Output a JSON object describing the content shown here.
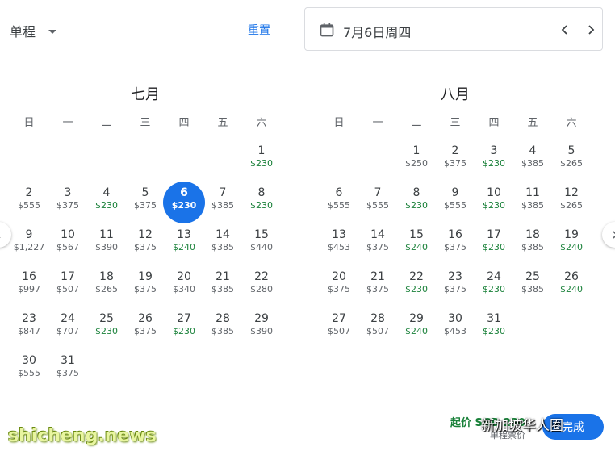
{
  "header": {
    "trip_type": "单程",
    "reset": "重置",
    "selected_date": "7月6日周四"
  },
  "weekdays": [
    "日",
    "一",
    "二",
    "三",
    "四",
    "五",
    "六"
  ],
  "months": [
    {
      "title": "七月",
      "lead_blanks": 6,
      "days": [
        {
          "d": "1",
          "p": "$230",
          "low": true
        },
        {
          "d": "2",
          "p": "$555"
        },
        {
          "d": "3",
          "p": "$375"
        },
        {
          "d": "4",
          "p": "$230",
          "low": true
        },
        {
          "d": "5",
          "p": "$375"
        },
        {
          "d": "6",
          "p": "$230",
          "low": true,
          "selected": true
        },
        {
          "d": "7",
          "p": "$385"
        },
        {
          "d": "8",
          "p": "$230",
          "low": true
        },
        {
          "d": "9",
          "p": "$1,227"
        },
        {
          "d": "10",
          "p": "$567"
        },
        {
          "d": "11",
          "p": "$390"
        },
        {
          "d": "12",
          "p": "$375"
        },
        {
          "d": "13",
          "p": "$240",
          "low": true
        },
        {
          "d": "14",
          "p": "$385"
        },
        {
          "d": "15",
          "p": "$440"
        },
        {
          "d": "16",
          "p": "$997"
        },
        {
          "d": "17",
          "p": "$507"
        },
        {
          "d": "18",
          "p": "$265"
        },
        {
          "d": "19",
          "p": "$375"
        },
        {
          "d": "20",
          "p": "$340"
        },
        {
          "d": "21",
          "p": "$385"
        },
        {
          "d": "22",
          "p": "$280"
        },
        {
          "d": "23",
          "p": "$847"
        },
        {
          "d": "24",
          "p": "$707"
        },
        {
          "d": "25",
          "p": "$230",
          "low": true
        },
        {
          "d": "26",
          "p": "$375"
        },
        {
          "d": "27",
          "p": "$230",
          "low": true
        },
        {
          "d": "28",
          "p": "$385"
        },
        {
          "d": "29",
          "p": "$390"
        },
        {
          "d": "30",
          "p": "$555"
        },
        {
          "d": "31",
          "p": "$375"
        }
      ]
    },
    {
      "title": "八月",
      "lead_blanks": 2,
      "days": [
        {
          "d": "1",
          "p": "$250"
        },
        {
          "d": "2",
          "p": "$375"
        },
        {
          "d": "3",
          "p": "$230",
          "low": true
        },
        {
          "d": "4",
          "p": "$385"
        },
        {
          "d": "5",
          "p": "$265"
        },
        {
          "d": "6",
          "p": "$555"
        },
        {
          "d": "7",
          "p": "$555"
        },
        {
          "d": "8",
          "p": "$230",
          "low": true
        },
        {
          "d": "9",
          "p": "$555"
        },
        {
          "d": "10",
          "p": "$230",
          "low": true
        },
        {
          "d": "11",
          "p": "$385"
        },
        {
          "d": "12",
          "p": "$265"
        },
        {
          "d": "13",
          "p": "$453"
        },
        {
          "d": "14",
          "p": "$375"
        },
        {
          "d": "15",
          "p": "$240",
          "low": true
        },
        {
          "d": "16",
          "p": "$375"
        },
        {
          "d": "17",
          "p": "$230",
          "low": true
        },
        {
          "d": "18",
          "p": "$385"
        },
        {
          "d": "19",
          "p": "$240",
          "low": true
        },
        {
          "d": "20",
          "p": "$375"
        },
        {
          "d": "21",
          "p": "$375"
        },
        {
          "d": "22",
          "p": "$230",
          "low": true
        },
        {
          "d": "23",
          "p": "$375"
        },
        {
          "d": "24",
          "p": "$230",
          "low": true
        },
        {
          "d": "25",
          "p": "$385"
        },
        {
          "d": "26",
          "p": "$240",
          "low": true
        },
        {
          "d": "27",
          "p": "$507"
        },
        {
          "d": "28",
          "p": "$507"
        },
        {
          "d": "29",
          "p": "$240",
          "low": true
        },
        {
          "d": "30",
          "p": "$453"
        },
        {
          "d": "31",
          "p": "$230",
          "low": true
        }
      ]
    }
  ],
  "footer": {
    "price_label": "起价 SGD 230",
    "sub_label": "单程票价",
    "done": "完成"
  },
  "watermarks": {
    "left": "shicheng.news",
    "right": "新加坡华人圈"
  },
  "colors": {
    "accent": "#1a73e8",
    "low_price": "#188038",
    "text": "#3c4043"
  },
  "icons": [
    "calendar-icon",
    "chevron-left-icon",
    "chevron-right-icon",
    "caret-down-icon"
  ]
}
